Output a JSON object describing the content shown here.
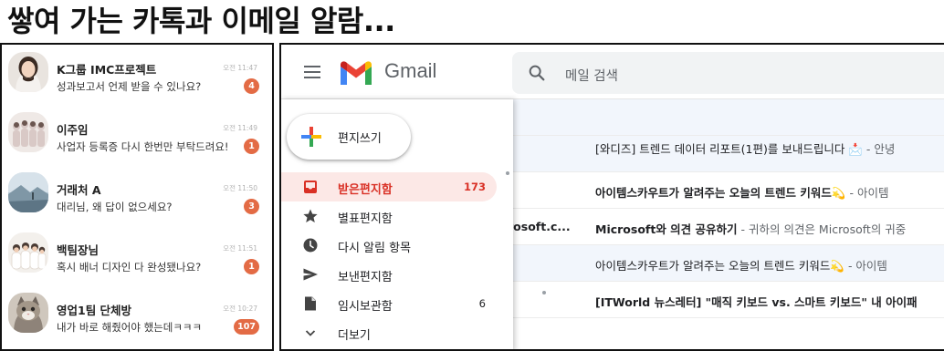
{
  "headline": "쌓여 가는 카톡과 이메일 알람...",
  "kakao": {
    "chats": [
      {
        "name": "K그룹 IMC프로젝트",
        "message": "성과보고서 언제 받을 수 있나요?",
        "time": "오전 11:47",
        "unread": "4",
        "avatar": "person-avatar"
      },
      {
        "name": "이주임",
        "message": "사업자 등록증 다시 한번만 부탁드려요!",
        "time": "오전 11:49",
        "unread": "1",
        "avatar": "group-photo-avatar"
      },
      {
        "name": "거래처 A",
        "message": "대리님, 왜 답이 없으세요?",
        "time": "오전 11:50",
        "unread": "3",
        "avatar": "landscape-avatar"
      },
      {
        "name": "백팀장님",
        "message": "혹시 배너 디자인 다 완성됐나요?",
        "time": "오전 11:51",
        "unread": "1",
        "avatar": "family-photo-avatar"
      },
      {
        "name": "영업1팀 단체방",
        "message": "내가 바로 해줬어야 했는데ㅋㅋㅋ",
        "time": "오전 10:27",
        "unread": "107",
        "avatar": "cat-avatar"
      }
    ],
    "badge_color": "#e36b45"
  },
  "gmail": {
    "brand": "Gmail",
    "search_placeholder": "메일 검색",
    "compose_label": "편지쓰기",
    "nav": [
      {
        "icon": "inbox-icon",
        "label": "받은편지함",
        "count": "173",
        "active": true
      },
      {
        "icon": "star-icon",
        "label": "별표편지함",
        "count": "",
        "active": false
      },
      {
        "icon": "clock-icon",
        "label": "다시 알림 항목",
        "count": "",
        "active": false
      },
      {
        "icon": "send-icon",
        "label": "보낸편지함",
        "count": "",
        "active": false
      },
      {
        "icon": "draft-icon",
        "label": "임시보관함",
        "count": "6",
        "active": false
      },
      {
        "icon": "chevron-down-icon",
        "label": "더보기",
        "count": "",
        "active": false
      }
    ],
    "mails": [
      {
        "sender": "",
        "subject": "",
        "snippet": "",
        "read": true
      },
      {
        "sender": "",
        "subject": "[와디즈] 트렌드 데이터 리포트(1편)를 보내드립니다 📩",
        "snippet": " - 안녕",
        "read": true
      },
      {
        "sender": "",
        "subject": "아이템스카우트가 알려주는 오늘의 트렌드 키워드💫",
        "snippet": " - 아이템",
        "read": false
      },
      {
        "sender": "rosoft.c...",
        "subject": "Microsoft와 의견 공유하기",
        "snippet": " - 귀하의 의견은 Microsoft의 귀중",
        "read": false
      },
      {
        "sender": "",
        "subject": "아이템스카우트가 알려주는 오늘의 트렌드 키워드💫",
        "snippet": " - 아이템",
        "read": true
      },
      {
        "sender": "",
        "subject": "[ITWorld 뉴스레터] \"매직 키보드 vs. 스마트 키보드\" 내 아이패",
        "snippet": "",
        "read": false
      }
    ],
    "accent_color": "#d93025"
  }
}
